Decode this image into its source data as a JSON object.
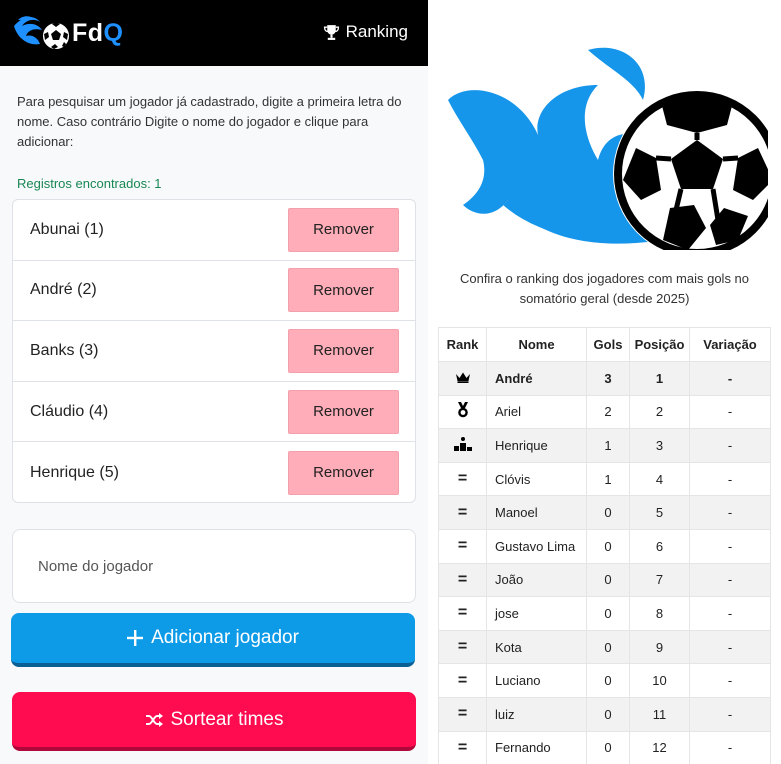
{
  "header": {
    "brand": "Fd",
    "brand_q": "Q",
    "ranking_label": "Ranking",
    "colors": {
      "background": "#000000",
      "brand_accent": "#1e90ff"
    }
  },
  "search": {
    "help_text": "Para pesquisar um jogador já cadastrado, digite a primeira letra do nome. Caso contrário Digite o nome do jogador e clique para adicionar:",
    "found_text": "Registros encontrados: 1"
  },
  "players": [
    {
      "label": "Abunai (1)",
      "remove_label": "Remover"
    },
    {
      "label": "André (2)",
      "remove_label": "Remover"
    },
    {
      "label": "Banks (3)",
      "remove_label": "Remover"
    },
    {
      "label": "Cláudio (4)",
      "remove_label": "Remover"
    },
    {
      "label": "Henrique (5)",
      "remove_label": "Remover"
    }
  ],
  "input": {
    "placeholder": "Nome do jogador"
  },
  "buttons": {
    "add_label": "Adicionar jogador",
    "sort_label": "Sortear times",
    "add_color": "#0d9be8",
    "sort_color": "#ff0b4f",
    "remove_color": "#ffadb8"
  },
  "ranking": {
    "caption": "Confira o ranking dos jogadores com mais gols no somatório geral (desde 2025)",
    "headers": [
      "Rank",
      "Nome",
      "Gols",
      "Posição",
      "Variação"
    ],
    "rows": [
      {
        "icon": "crown-icon",
        "name": "André",
        "gols": "3",
        "pos": "1",
        "var": "-"
      },
      {
        "icon": "medal-icon",
        "name": "Ariel",
        "gols": "2",
        "pos": "2",
        "var": "-"
      },
      {
        "icon": "podium-icon",
        "name": "Henrique",
        "gols": "1",
        "pos": "3",
        "var": "-"
      },
      {
        "icon": "equals-icon",
        "name": "Clóvis",
        "gols": "1",
        "pos": "4",
        "var": "-"
      },
      {
        "icon": "equals-icon",
        "name": "Manoel",
        "gols": "0",
        "pos": "5",
        "var": "-"
      },
      {
        "icon": "equals-icon",
        "name": "Gustavo Lima",
        "gols": "0",
        "pos": "6",
        "var": "-"
      },
      {
        "icon": "equals-icon",
        "name": "João",
        "gols": "0",
        "pos": "7",
        "var": "-"
      },
      {
        "icon": "equals-icon",
        "name": "jose",
        "gols": "0",
        "pos": "8",
        "var": "-"
      },
      {
        "icon": "equals-icon",
        "name": "Kota",
        "gols": "0",
        "pos": "9",
        "var": "-"
      },
      {
        "icon": "equals-icon",
        "name": "Luciano",
        "gols": "0",
        "pos": "10",
        "var": "-"
      },
      {
        "icon": "equals-icon",
        "name": "luiz",
        "gols": "0",
        "pos": "11",
        "var": "-"
      },
      {
        "icon": "equals-icon",
        "name": "Fernando",
        "gols": "0",
        "pos": "12",
        "var": "-"
      }
    ]
  }
}
